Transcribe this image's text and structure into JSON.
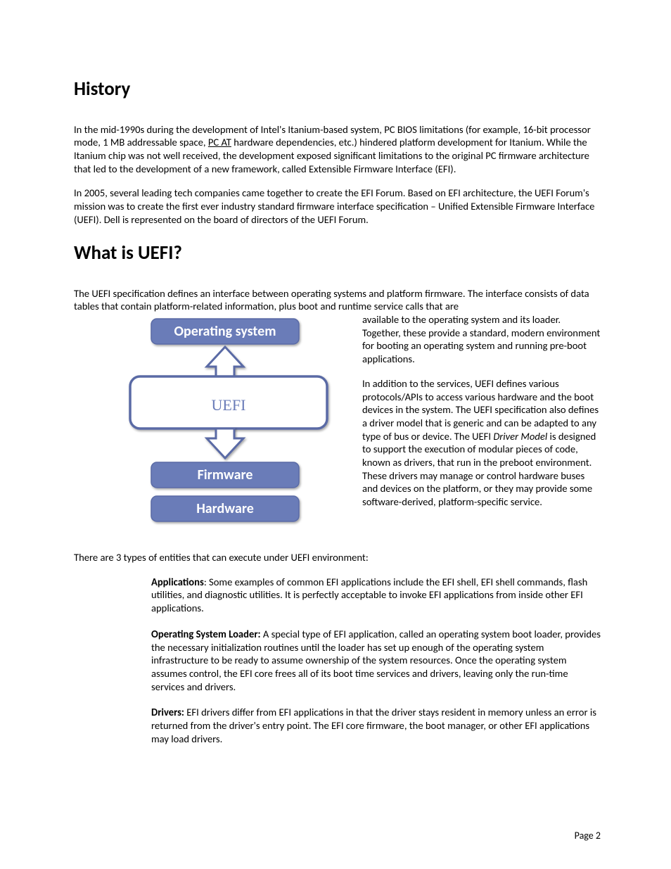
{
  "headings": {
    "history": "History",
    "whatis": "What is UEFI?"
  },
  "history": {
    "p1_a": "In the mid-1990s during the development of Intel's Itanium-based system, PC BIOS limitations (for example, 16-bit processor mode, 1 MB addressable space, ",
    "p1_link": "PC AT",
    "p1_b": " hardware dependencies, etc.) hindered platform development for Itanium.  While the Itanium chip was not well received, the development exposed significant limitations to the original PC firmware architecture that led to the development of a new framework, called Extensible Firmware Interface (EFI).",
    "p2": "In 2005, several leading tech companies came together to create the EFI Forum. Based on EFI architecture, the UEFI Forum's mission was to create the first ever industry standard firmware interface specification – Unified Extensible Firmware Interface (UEFI).  Dell is represented on the board of directors of the UEFI Forum."
  },
  "whatis": {
    "p1": "The UEFI specification defines an interface between operating systems and platform firmware. The interface consists of data tables that contain platform-related information, plus boot and runtime service calls that are available to the operating system and its loader. Together, these provide a standard, modern environment for booting an operating system and running pre-boot applications.",
    "p2_a": "In addition to the services, UEFI defines various protocols/APIs to access various hardware and the boot devices in the system. The UEFI specification also defines a driver model that is generic and can be adapted to any type of bus or device.  The UEFI ",
    "p2_em": "Driver Model",
    "p2_b": " is designed to support the execution of modular pieces of code, known as drivers, that run in the preboot environment. These drivers may manage or control hardware buses and devices on the platform, or they may provide some software-derived, platform-specific service.",
    "entities_intro": "There are 3 types of entities that can execute under UEFI environment:",
    "entities": [
      {
        "title": "Applications",
        "sep": ": ",
        "body": "Some examples of common EFI applications include the EFI shell, EFI shell commands, flash utilities, and diagnostic utilities. It is perfectly acceptable to invoke EFI applications from inside other EFI applications."
      },
      {
        "title": "Operating System Loader:",
        "sep": " ",
        "body": "A special type of EFI application, called an operating system boot loader, provides the necessary initialization routines until the loader has set up enough of the operating system infrastructure to be ready to assume ownership of the system resources. Once the operating system assumes control, the EFI core frees all of its boot time services and drivers, leaving only the run-time services and drivers."
      },
      {
        "title": "Drivers:",
        "sep": " ",
        "body": "EFI drivers differ from EFI applications in that the driver stays resident in memory unless an error is returned from the driver's entry point. The EFI core firmware, the boot manager, or other EFI applications may load drivers."
      }
    ]
  },
  "diagram": {
    "layers": {
      "os": "Operating system",
      "uefi": "UEFI",
      "firmware": "Firmware",
      "hardware": "Hardware"
    },
    "colors": {
      "fill": "#6a7cb8",
      "border": "#5a6ba5",
      "uefi_text": "#5a6ba5"
    }
  },
  "footer": "Page 2"
}
